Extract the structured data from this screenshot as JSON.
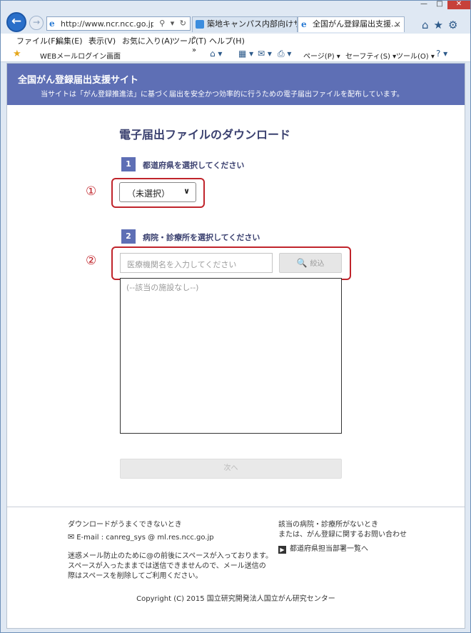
{
  "browser": {
    "window_controls": {
      "minimize": "—",
      "maximize": "□",
      "close": "✕"
    },
    "back_icon": "←",
    "forward_icon": "→",
    "url": "http://www.ncr.ncc.go.jp/en",
    "address_icons": "⚲ ▾ ↻",
    "tabs": [
      {
        "title": "築地キャンパス内部向けサー...",
        "close": ""
      },
      {
        "title": "全国がん登録届出支援...",
        "close": "×"
      }
    ],
    "right_icons": "⌂★⚙",
    "menu": [
      "ファイル(F)",
      "編集(E)",
      "表示(V)",
      "お気に入り(A)",
      "ツール(T)",
      "ヘルプ(H)"
    ],
    "chevron": "»",
    "favorites": {
      "star": "★",
      "link": "WEBメールログイン画面"
    },
    "commands": {
      "home": "⌂ ▾",
      "feeds": "▦ ▾",
      "mail": "✉ ▾",
      "print": "⎙ ▾",
      "page": "ページ(P) ▾",
      "safety": "セーフティ(S) ▾",
      "tools": "ツール(O) ▾",
      "help": "? ▾"
    }
  },
  "site": {
    "title": "全国がん登録届出支援サイト",
    "description": "当サイトは「がん登録推進法」に基づく届出を安全かつ効率的に行うための電子届出ファイルを配布しています。"
  },
  "main": {
    "heading": "電子届出ファイルのダウンロード",
    "step1": {
      "number": "1",
      "label": "都道府県を選択してください"
    },
    "step2": {
      "number": "2",
      "label": "病院・診療所を選択してください"
    },
    "markers": [
      "①",
      "②"
    ],
    "prefecture_select": {
      "value": "（未選択）",
      "chevron": "∨"
    },
    "search": {
      "placeholder": "医療機関名を入力してください",
      "button": "絞込",
      "icon": "🔍"
    },
    "results_empty": "(--該当の施設なし--)",
    "next_button": "次へ"
  },
  "footer": {
    "left": {
      "heading": "ダウンロードがうまくできないとき",
      "email": "E-mail : canreg_sys @ ml.res.ncc.go.jp",
      "mail_icon": "✉",
      "note": [
        "迷惑メール防止のために@の前後にスペースが入っております。",
        "スペースが入ったままでは送信できませんので、メール送信の",
        "際はスペースを削除してご利用ください。"
      ]
    },
    "right": {
      "line1": "該当の病院・診療所がないとき",
      "line2": "または、がん登録に関するお問い合わせ",
      "link": "都道府県担当部署一覧へ",
      "arrow_icon": "▶"
    },
    "copyright": "Copyright (C) 2015 国立研究開発法人国立がん研究センター"
  }
}
